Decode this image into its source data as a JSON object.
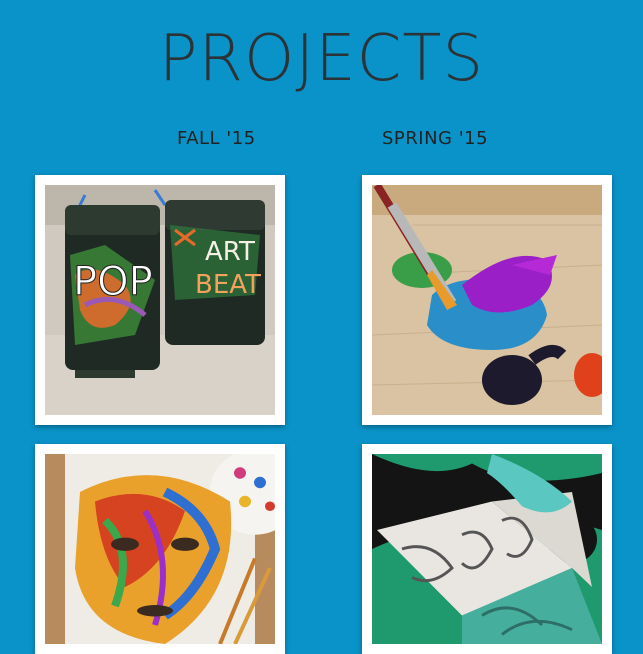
{
  "header": {
    "title": "PROJECTS"
  },
  "columns": [
    {
      "label": "FALL '15"
    },
    {
      "label": "SPRING '15"
    }
  ],
  "colors": {
    "background": "#0a93c9",
    "title": "#2b3336",
    "card": "#ffffff"
  },
  "projects": [
    {
      "icon": "graffiti-bins-photo"
    },
    {
      "icon": "paintbrush-photo"
    },
    {
      "icon": "painted-mask-photo"
    },
    {
      "icon": "printmaking-photo"
    }
  ]
}
